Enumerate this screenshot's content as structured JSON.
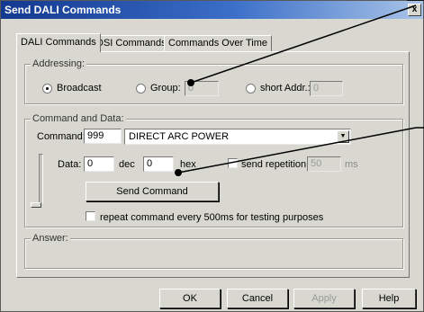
{
  "window": {
    "title": "Send DALI Commands",
    "close_glyph": "x"
  },
  "tabs": [
    {
      "label": "DALI Commands",
      "active": true
    },
    {
      "label": "DSI Commands",
      "active": false
    },
    {
      "label": "Commands Over Time",
      "active": false
    }
  ],
  "addressing": {
    "legend": "Addressing:",
    "broadcast_label": "Broadcast",
    "group_label": "Group:",
    "group_value": "0",
    "short_addr_label": "short Addr.:",
    "short_addr_value": "0",
    "selected": "Broadcast"
  },
  "command": {
    "legend": "Command and Data:",
    "command_label": "Command:",
    "command_number": "999",
    "command_name": "DIRECT ARC POWER",
    "data_label": "Data:",
    "data_dec_value": "0",
    "dec_label": "dec",
    "data_hex_value": "0",
    "hex_label": "hex",
    "send_repetition_label": "send repetition:",
    "send_repetition_checked": false,
    "repetition_value": "50",
    "ms_label": "ms",
    "send_button_label": "Send Command",
    "repeat_label": "repeat command every 500ms for testing purposes",
    "repeat_checked": false
  },
  "answer": {
    "legend": "Answer:"
  },
  "footer": {
    "ok_label": "OK",
    "cancel_label": "Cancel",
    "apply_label": "Apply",
    "help_label": "Help"
  },
  "colors": {
    "title_bar": "#13388f",
    "dialog_bg": "#d8d8d0",
    "callout_line": "#000000"
  }
}
